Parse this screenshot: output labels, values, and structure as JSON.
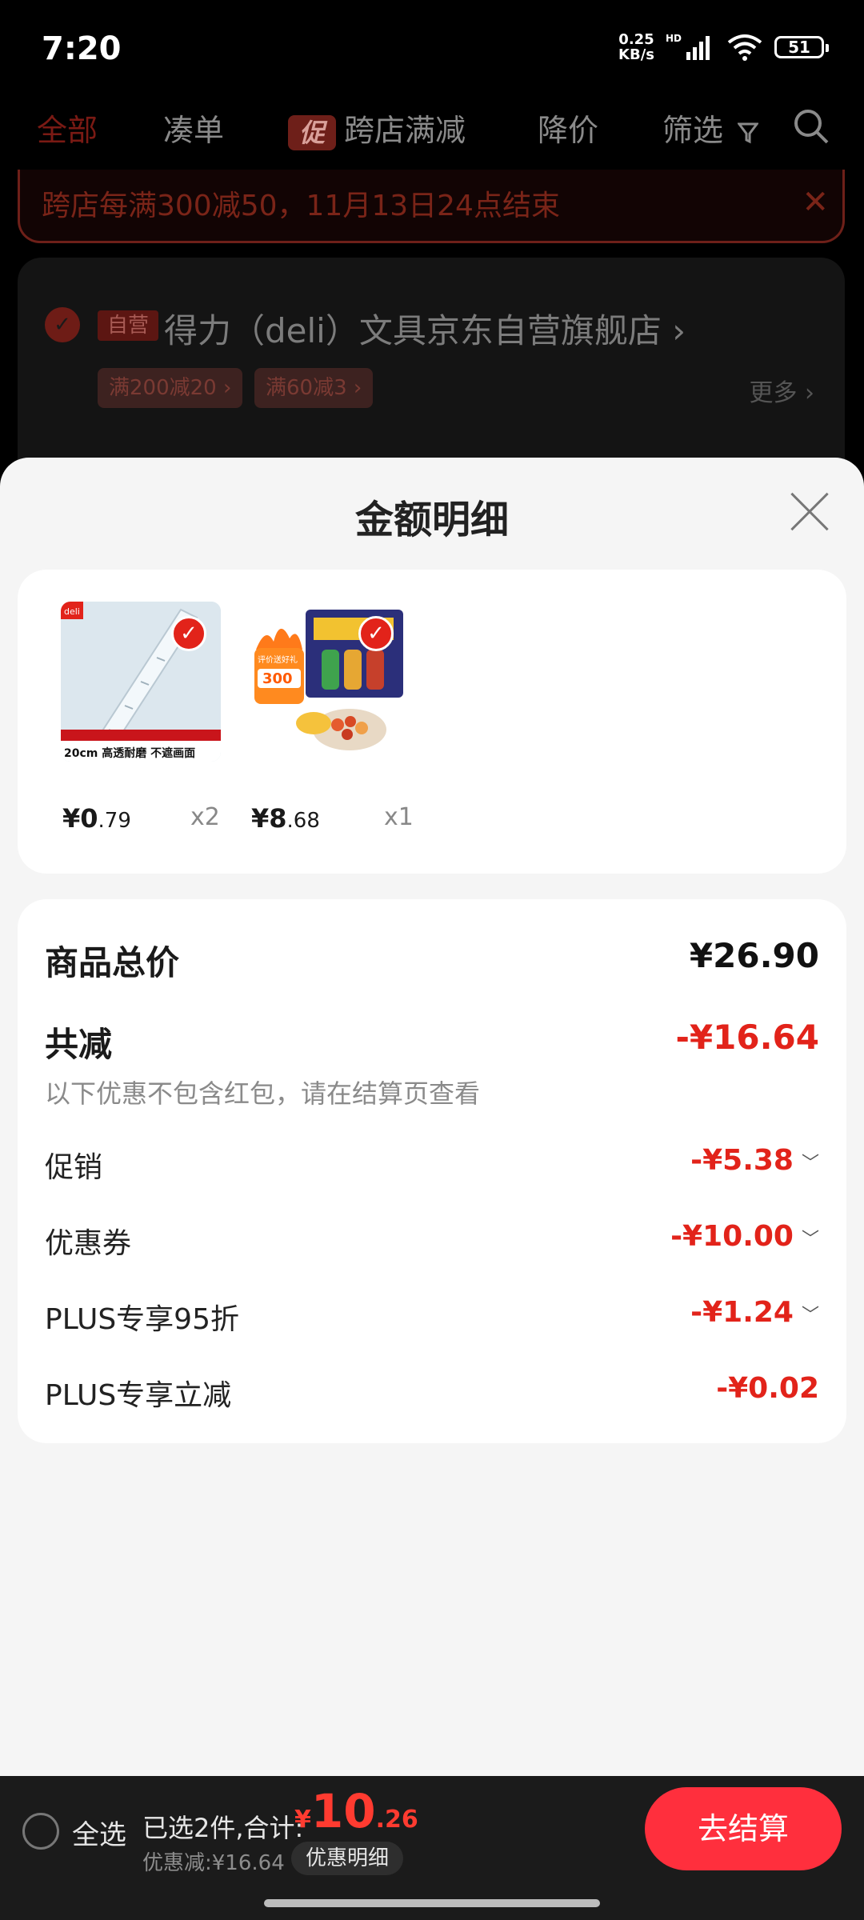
{
  "status_bar": {
    "time": "7:20",
    "net_speed_value": "0.25",
    "net_speed_unit": "KB/s",
    "network_label": "HD",
    "battery": "51"
  },
  "top_tabs": [
    {
      "label": "全部",
      "active": true
    },
    {
      "label": "凑单"
    },
    {
      "label": "跨店满减",
      "chip": "促"
    },
    {
      "label": "降价"
    },
    {
      "label": "筛选"
    }
  ],
  "notice": {
    "text": "跨店每满300减50，11月13日24点结束",
    "close": "✕"
  },
  "store": {
    "badge": "自营",
    "name": "得力（deli）文具京东自营旗舰店",
    "coupons": [
      "满200减20 ›",
      "满60减3 ›"
    ],
    "more": "更多 ›"
  },
  "sheet": {
    "title": "金额明细",
    "products": [
      {
        "price_main": "¥0",
        "price_decimal": ".79",
        "qty": "x2",
        "thumb_caption": "20cm 高透耐磨 不遮画面",
        "brand": "deli"
      },
      {
        "price_main": "¥8",
        "price_decimal": ".68",
        "qty": "x1",
        "thumb_caption": "评价送好礼",
        "thumb_badge": "300"
      }
    ],
    "summary": {
      "total_label": "商品总价",
      "total_value": "¥26.90",
      "reduce_label": "共减",
      "reduce_value": "-¥16.64",
      "note": "以下优惠不包含红包，请在结算页查看",
      "items": [
        {
          "label": "促销",
          "value": "-¥5.38"
        },
        {
          "label": "优惠券",
          "value": "-¥10.00"
        },
        {
          "label": "PLUS专享95折",
          "value": "-¥1.24"
        },
        {
          "label": "PLUS专享立减",
          "value": "-¥0.02"
        }
      ]
    }
  },
  "bottom_bar": {
    "select_all": "全选",
    "selected": "已选2件,合计:",
    "currency": "¥",
    "total_main": "10",
    "total_decimal": ".26",
    "discount": "优惠减:¥16.64",
    "detail_button": "优惠明细",
    "checkout_button": "去结算"
  },
  "colors": {
    "accent": "#e2231a",
    "checkout": "#ff2f3d"
  }
}
